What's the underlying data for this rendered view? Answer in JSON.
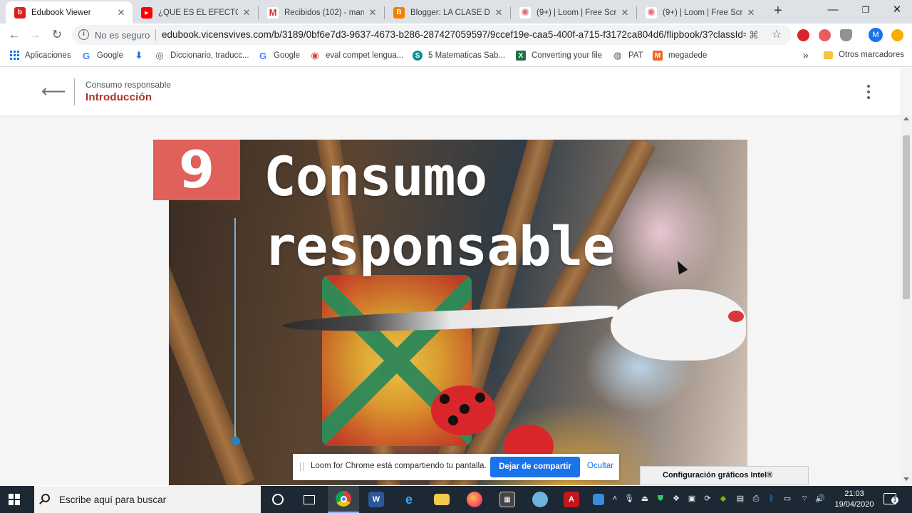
{
  "browser": {
    "tabs": [
      {
        "title": "Edubook Viewer",
        "icon": "edubook-icon",
        "color": "#d6211f",
        "glyph": "b",
        "active": true
      },
      {
        "title": "¿QUÉ ES EL EFECTO INV",
        "icon": "youtube-icon",
        "color": "#ff0000",
        "glyph": "▶",
        "active": false
      },
      {
        "title": "Recibidos (102) - marro",
        "icon": "gmail-icon",
        "color": "#d93025",
        "glyph": "M",
        "active": false
      },
      {
        "title": "Blogger: LA CLASE DE S",
        "icon": "blogger-icon",
        "color": "#f57d00",
        "glyph": "B",
        "active": false
      },
      {
        "title": "(9+) | Loom | Free Scree",
        "icon": "loom-icon",
        "color": "#e86a6a",
        "glyph": "✺",
        "active": false
      },
      {
        "title": "(9+) | Loom | Free Scree",
        "icon": "loom-icon",
        "color": "#e86a6a",
        "glyph": "✺",
        "active": false
      }
    ],
    "omnibox": {
      "security_text": "No es seguro",
      "url": "edubook.vicensvives.com/b/3189/0bf6e7d3-9637-4673-b286-287427059597/9ccef19e-caa5-400f-a715-f3172ca804d6/flipbook/3?classId=..."
    },
    "avatar_initial": "M",
    "bookmarks": [
      {
        "label": "Aplicaciones",
        "icon": "apps-grid-icon"
      },
      {
        "label": "Google",
        "icon": "google-icon",
        "color": "#4285f4",
        "glyph": "G"
      },
      {
        "label": "",
        "icon": "download-icon",
        "color": "#1a73e8",
        "glyph": "⬇"
      },
      {
        "label": "Diccionario, traducc...",
        "icon": "dictionary-icon",
        "color": "#555",
        "glyph": "◎"
      },
      {
        "label": "Google",
        "icon": "google-icon",
        "color": "#4285f4",
        "glyph": "G"
      },
      {
        "label": "eval compet lengua...",
        "icon": "target-icon",
        "color": "#e8453c",
        "glyph": "◉"
      },
      {
        "label": "5 Matematicas Sab...",
        "icon": "globe-icon",
        "color": "#0f8c8c",
        "glyph": "S"
      },
      {
        "label": "Converting your file",
        "icon": "excel-icon",
        "color": "#1e7145",
        "glyph": "X"
      },
      {
        "label": "PAT",
        "icon": "globe-icon",
        "color": "#555",
        "glyph": "◍"
      },
      {
        "label": "megadede",
        "icon": "megadede-icon",
        "color": "#f26522",
        "glyph": "M"
      }
    ],
    "bookmarks_overflow": "»",
    "other_bookmarks": "Otros marcadores"
  },
  "page": {
    "header": {
      "subtitle": "Consumo responsable",
      "title": "Introducción"
    },
    "cover": {
      "chapter_number": "9",
      "title_line1": "Consumo",
      "title_line2": "responsable"
    }
  },
  "loom_bar": {
    "message": "Loom for Chrome está compartiendo tu pantalla.",
    "stop_label": "Dejar de compartir",
    "hide_label": "Ocultar"
  },
  "intel_popup": "Configuración gráficos Intel®",
  "taskbar": {
    "search_placeholder": "Escribe aquí para buscar",
    "time": "21:03",
    "date": "19/04/2020",
    "notifications": "1"
  }
}
